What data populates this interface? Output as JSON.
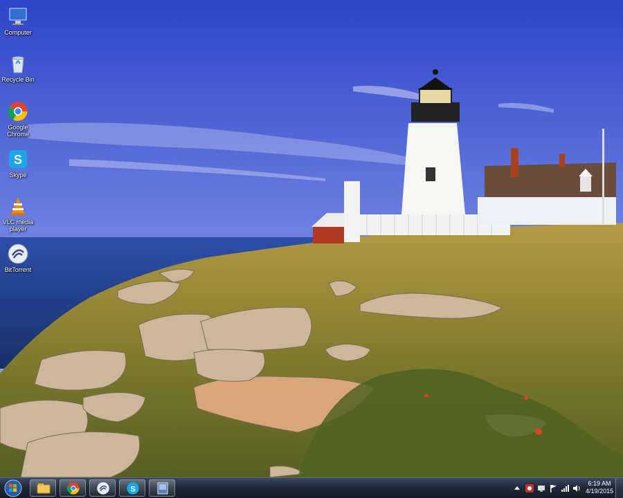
{
  "desktop": {
    "icons": [
      {
        "label": "Computer",
        "icon": "computer-icon"
      },
      {
        "label": "Recycle Bin",
        "icon": "recycle-bin-icon"
      },
      {
        "label": "Google Chrome",
        "icon": "chrome-icon"
      },
      {
        "label": "Skype",
        "icon": "skype-icon"
      },
      {
        "label": "VLC media player",
        "icon": "vlc-icon"
      },
      {
        "label": "BitTorrent",
        "icon": "bittorrent-icon"
      }
    ],
    "wallpaper": "lighthouse-on-rocky-coast"
  },
  "taskbar": {
    "pinned": [
      {
        "icon": "file-explorer-icon"
      },
      {
        "icon": "chrome-icon"
      },
      {
        "icon": "bittorrent-icon"
      },
      {
        "icon": "skype-icon"
      },
      {
        "icon": "app-window-icon"
      }
    ],
    "clock": {
      "time": "6:19 AM",
      "date": "4/19/2015"
    },
    "tray_icons": [
      "show-hidden-icons-arrow",
      "security-icon",
      "network-icon",
      "action-center-flag-icon",
      "network-bars-icon",
      "volume-icon"
    ]
  },
  "colors": {
    "sky_top": "#3a4fd0",
    "sea": "#1f3f8a",
    "grass": "#9a8a3a",
    "taskbar": "#1f2a3a"
  }
}
